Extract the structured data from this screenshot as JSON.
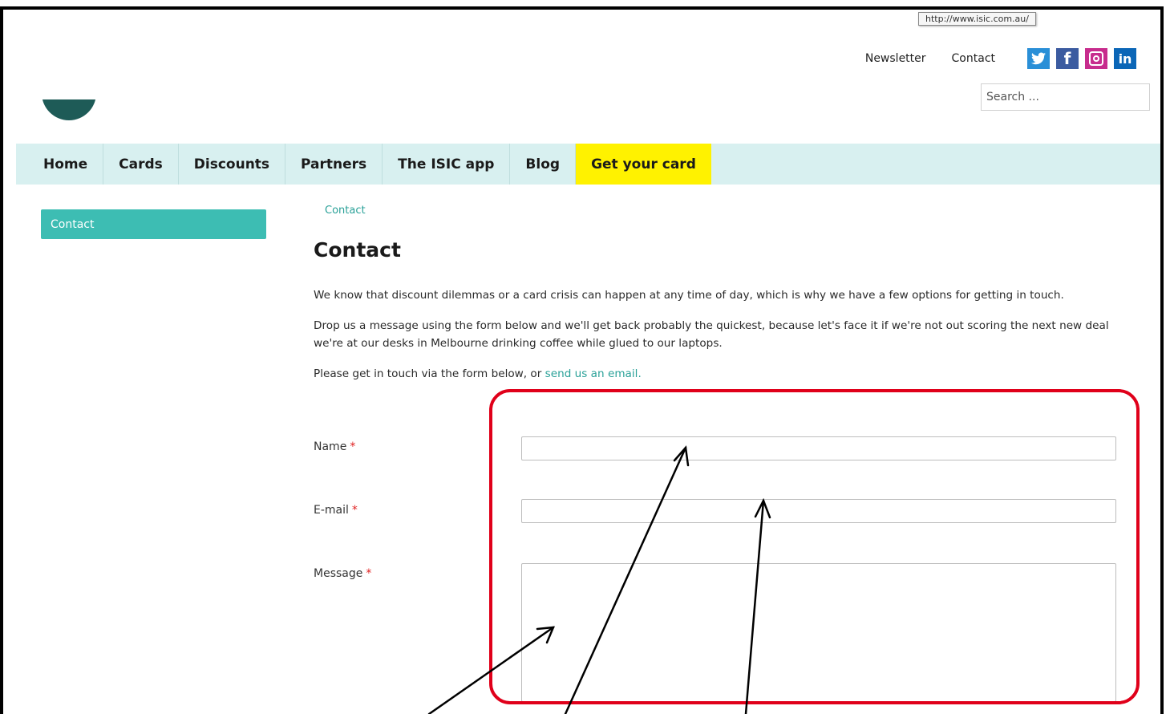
{
  "tooltip": "http://www.isic.com.au/",
  "header": {
    "links": [
      "Newsletter",
      "Contact"
    ],
    "social": [
      "twitter-icon",
      "facebook-icon",
      "instagram-icon",
      "linkedin-icon"
    ],
    "search_placeholder": "Search ..."
  },
  "nav": {
    "items": [
      "Home",
      "Cards",
      "Discounts",
      "Partners",
      "The ISIC app",
      "Blog"
    ],
    "cta": "Get your card"
  },
  "sidebar": {
    "active": "Contact"
  },
  "content": {
    "breadcrumb": "Contact",
    "title": "Contact",
    "p1": "We know that discount dilemmas or a card crisis can happen at any time of day, which is why we have a few options for getting in touch.",
    "p2": "Drop us a message using the form below and we'll get back probably the quickest, because let's face it if we're not out scoring the next new deal we're at our desks in Melbourne drinking coffee while glued to our laptops.",
    "p3_prefix": "Please get in touch via the form below, or ",
    "p3_link": "send us an email."
  },
  "form": {
    "name_label": "Name",
    "email_label": "E-mail",
    "message_label": "Message",
    "required_mark": "*"
  },
  "colors": {
    "nav_bg": "#d8f0f0",
    "cta_bg": "#fff200",
    "accent": "#3dbdb3",
    "annotation": "#e0001a"
  }
}
